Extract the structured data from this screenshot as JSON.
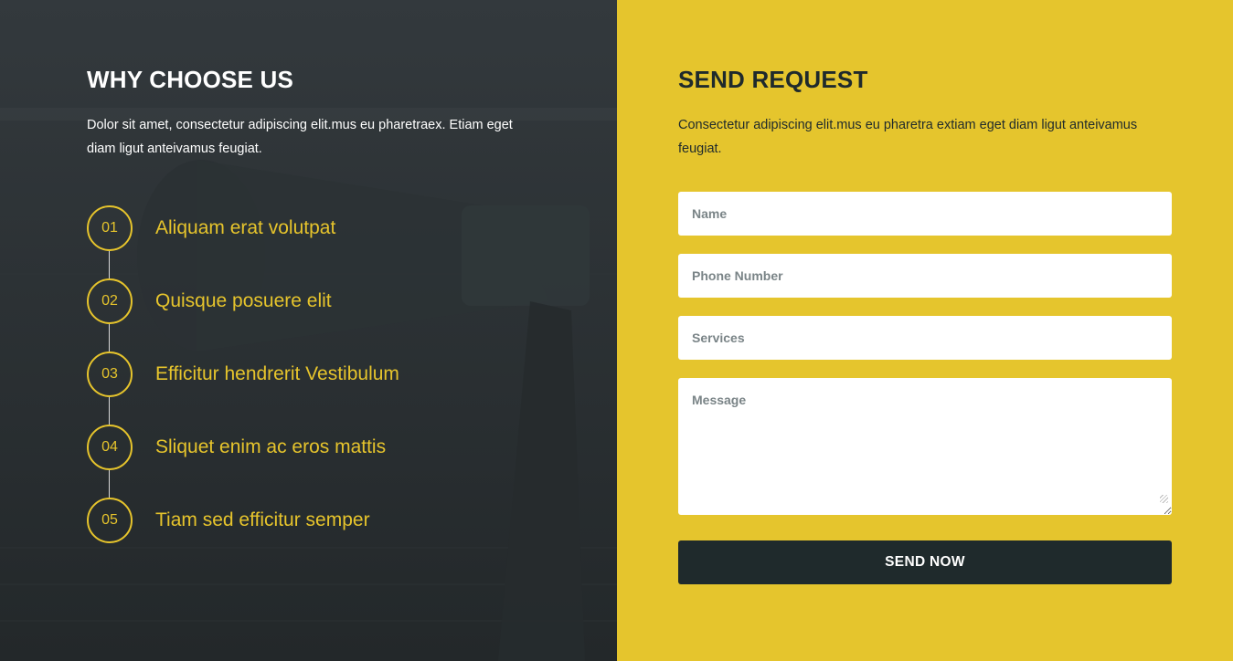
{
  "why_choose": {
    "title": "WHY CHOOSE US",
    "intro": "Dolor sit amet, consectetur adipiscing elit.mus eu pharetraex. Etiam eget diam ligut anteivamus feugiat.",
    "items": [
      {
        "number": "01",
        "label": "Aliquam erat volutpat"
      },
      {
        "number": "02",
        "label": "Quisque posuere elit"
      },
      {
        "number": "03",
        "label": "Efficitur hendrerit Vestibulum"
      },
      {
        "number": "04",
        "label": "Sliquet enim ac eros mattis"
      },
      {
        "number": "05",
        "label": "Tiam sed efficitur semper"
      }
    ]
  },
  "send_request": {
    "title": "SEND REQUEST",
    "intro": "Consectetur adipiscing elit.mus eu pharetra extiam eget diam ligut anteivamus feugiat.",
    "fields": {
      "name_placeholder": "Name",
      "phone_placeholder": "Phone Number",
      "services_placeholder": "Services",
      "message_placeholder": "Message"
    },
    "submit_label": "SEND NOW"
  },
  "colors": {
    "accent_yellow": "#e5c52d",
    "dark": "#1f2a2c",
    "left_overlay": "#2a3033"
  }
}
